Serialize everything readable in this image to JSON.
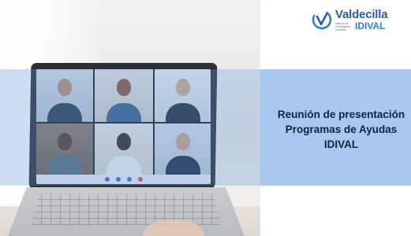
{
  "logo": {
    "name": "Valdecilla",
    "subtitle": "Instituto de Investigación Sanitaria",
    "brand": "IDIVAL",
    "colors": {
      "primary": "#2b5ea7",
      "accent": "#2f7fd1"
    }
  },
  "headline": {
    "line1": "Reunión de presentación",
    "line2": "Programas de Ayudas",
    "line3": "IDIVAL"
  },
  "photo": {
    "subject": "laptop-video-call",
    "participants": 6
  },
  "colors": {
    "band": "#a8c8ef",
    "headline_text": "#0f2240"
  }
}
